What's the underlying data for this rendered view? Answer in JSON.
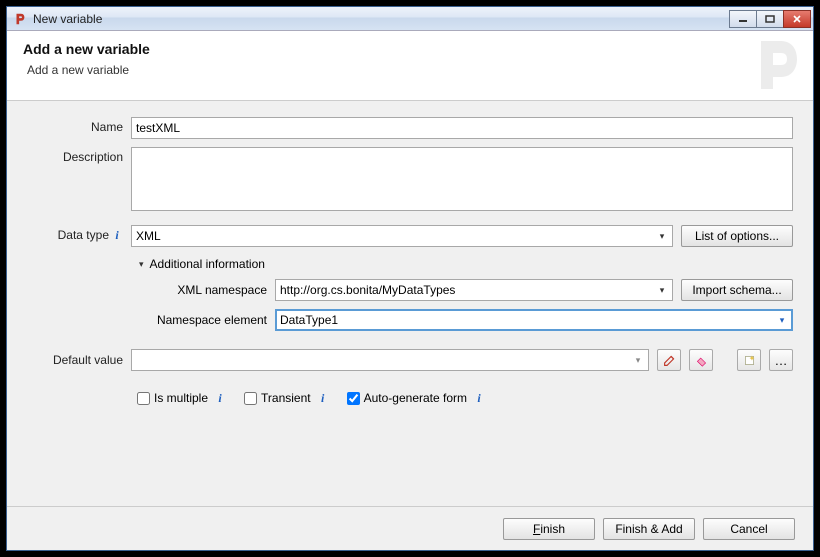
{
  "window": {
    "title": "New variable"
  },
  "header": {
    "title": "Add a new variable",
    "subtitle": "Add a new variable"
  },
  "form": {
    "name_label": "Name",
    "name_value": "testXML",
    "description_label": "Description",
    "description_value": "",
    "datatype_label": "Data type",
    "datatype_value": "XML",
    "list_of_options": "List of options...",
    "additional_info": "Additional information",
    "xml_namespace_label": "XML namespace",
    "xml_namespace_value": "http://org.cs.bonita/MyDataTypes",
    "import_schema": "Import schema...",
    "namespace_element_label": "Namespace element",
    "namespace_element_value": "DataType1",
    "default_value_label": "Default value",
    "default_value_value": "",
    "is_multiple_label": "Is multiple",
    "is_multiple_checked": false,
    "transient_label": "Transient",
    "transient_checked": false,
    "autogenerate_label": "Auto-generate form",
    "autogenerate_checked": true
  },
  "footer": {
    "finish": "Finish",
    "finish_add": "Finish & Add",
    "cancel": "Cancel"
  }
}
